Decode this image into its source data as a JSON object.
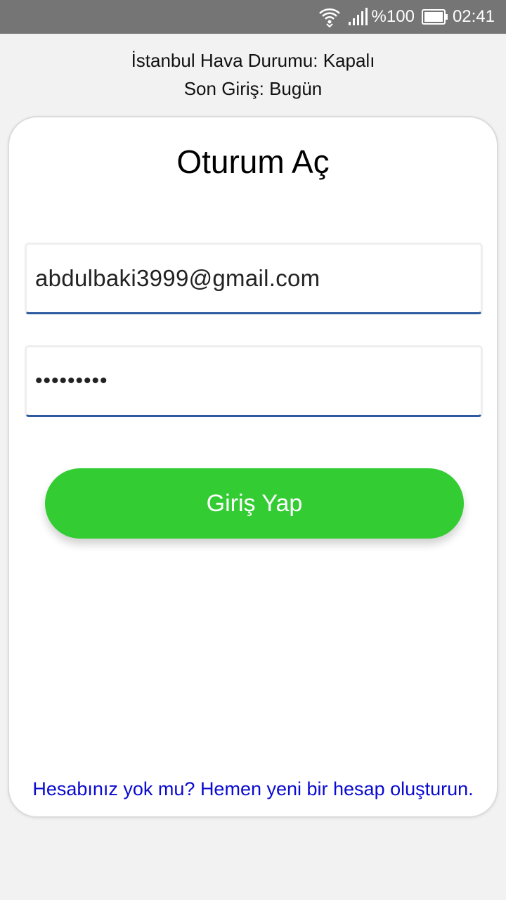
{
  "status_bar": {
    "battery_text": "%100",
    "time": "02:41",
    "icons": [
      "wifi-icon",
      "signal-icon",
      "battery-icon"
    ]
  },
  "header": {
    "weather": "İstanbul Hava Durumu: Kapalı",
    "last_login": "Son Giriş: Bugün"
  },
  "login": {
    "title": "Oturum Aç",
    "email_value": "abdulbaki3999@gmail.com",
    "password_value": "•••••••••",
    "submit_label": "Giriş Yap",
    "signup_link": "Hesabınız yok mu? Hemen yeni bir hesap oluşturun."
  },
  "colors": {
    "accent_green": "#33cc33",
    "input_underline": "#2d5aa0",
    "link_blue": "#0a0ad0",
    "status_bar": "#757575"
  }
}
